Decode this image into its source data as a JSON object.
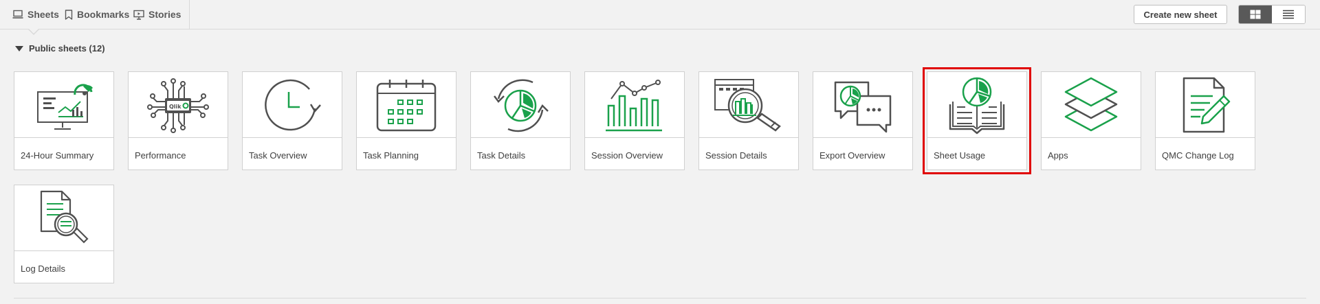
{
  "nav": {
    "sheets_label": "Sheets",
    "bookmarks_label": "Bookmarks",
    "stories_label": "Stories"
  },
  "toolbar": {
    "create_label": "Create new sheet",
    "grid_view_icon": "grid-icon",
    "list_view_icon": "list-icon"
  },
  "section": {
    "title": "Public sheets (12)"
  },
  "colors": {
    "accent": "#1aa14b",
    "icon_gray": "#505050",
    "selected_outline": "#e00000"
  },
  "sheets": [
    {
      "label": "24-Hour Summary",
      "icon": "dashboard-monitor-icon"
    },
    {
      "label": "Performance",
      "icon": "circuit-chip-icon"
    },
    {
      "label": "Task Overview",
      "icon": "clock-refresh-icon"
    },
    {
      "label": "Task Planning",
      "icon": "calendar-icon"
    },
    {
      "label": "Task Details",
      "icon": "pie-refresh-icon"
    },
    {
      "label": "Session Overview",
      "icon": "bar-line-chart-icon"
    },
    {
      "label": "Session Details",
      "icon": "magnify-chart-icon"
    },
    {
      "label": "Export Overview",
      "icon": "chat-bubbles-icon"
    },
    {
      "label": "Sheet Usage",
      "icon": "book-pie-icon"
    },
    {
      "label": "Apps",
      "icon": "layers-icon"
    },
    {
      "label": "QMC Change Log",
      "icon": "document-pencil-icon"
    },
    {
      "label": "Log Details",
      "icon": "document-magnify-icon"
    }
  ]
}
